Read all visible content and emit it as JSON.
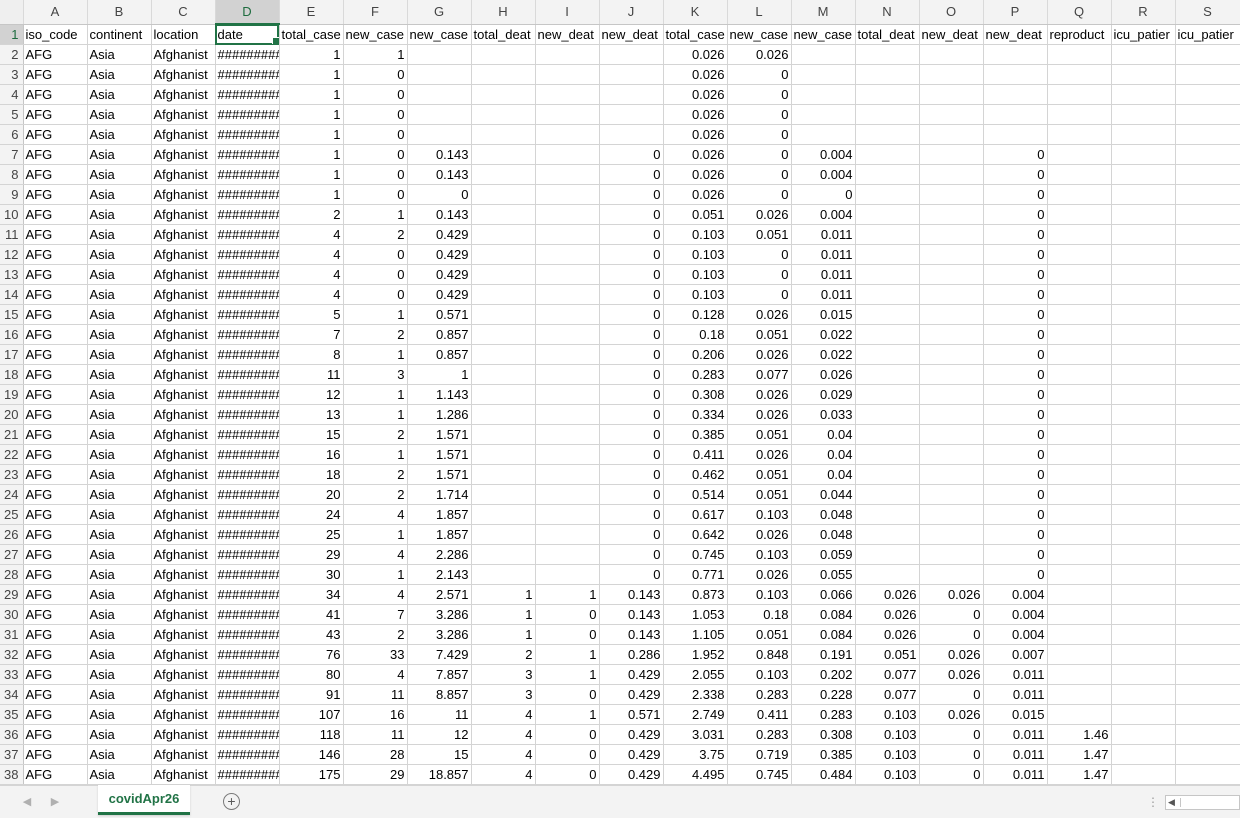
{
  "columns": [
    "A",
    "B",
    "C",
    "D",
    "E",
    "F",
    "G",
    "H",
    "I",
    "J",
    "K",
    "L",
    "M",
    "N",
    "O",
    "P",
    "Q",
    "R",
    "S"
  ],
  "column_types": [
    "txt",
    "txt",
    "txt",
    "txt",
    "num",
    "num",
    "num",
    "num",
    "num",
    "num",
    "num",
    "num",
    "num",
    "num",
    "num",
    "num",
    "num",
    "txt",
    "txt"
  ],
  "selected_column": "D",
  "active_cell": {
    "row": 1,
    "col": 3
  },
  "rows": [
    [
      "iso_code",
      "continent",
      "location",
      "date",
      "total_case",
      "new_case",
      "new_case",
      "total_deat",
      "new_deat",
      "new_deat",
      "total_case",
      "new_case",
      "new_case",
      "total_deat",
      "new_deat",
      "new_deat",
      "reproduct",
      "icu_patier",
      "icu_patier"
    ],
    [
      "AFG",
      "Asia",
      "Afghanist",
      "#########",
      "1",
      "1",
      "",
      "",
      "",
      "",
      "0.026",
      "0.026",
      "",
      "",
      "",
      "",
      "",
      "",
      ""
    ],
    [
      "AFG",
      "Asia",
      "Afghanist",
      "#########",
      "1",
      "0",
      "",
      "",
      "",
      "",
      "0.026",
      "0",
      "",
      "",
      "",
      "",
      "",
      "",
      ""
    ],
    [
      "AFG",
      "Asia",
      "Afghanist",
      "#########",
      "1",
      "0",
      "",
      "",
      "",
      "",
      "0.026",
      "0",
      "",
      "",
      "",
      "",
      "",
      "",
      ""
    ],
    [
      "AFG",
      "Asia",
      "Afghanist",
      "#########",
      "1",
      "0",
      "",
      "",
      "",
      "",
      "0.026",
      "0",
      "",
      "",
      "",
      "",
      "",
      "",
      ""
    ],
    [
      "AFG",
      "Asia",
      "Afghanist",
      "#########",
      "1",
      "0",
      "",
      "",
      "",
      "",
      "0.026",
      "0",
      "",
      "",
      "",
      "",
      "",
      "",
      ""
    ],
    [
      "AFG",
      "Asia",
      "Afghanist",
      "#########",
      "1",
      "0",
      "0.143",
      "",
      "",
      "0",
      "0.026",
      "0",
      "0.004",
      "",
      "",
      "0",
      "",
      "",
      ""
    ],
    [
      "AFG",
      "Asia",
      "Afghanist",
      "#########",
      "1",
      "0",
      "0.143",
      "",
      "",
      "0",
      "0.026",
      "0",
      "0.004",
      "",
      "",
      "0",
      "",
      "",
      ""
    ],
    [
      "AFG",
      "Asia",
      "Afghanist",
      "#########",
      "1",
      "0",
      "0",
      "",
      "",
      "0",
      "0.026",
      "0",
      "0",
      "",
      "",
      "0",
      "",
      "",
      ""
    ],
    [
      "AFG",
      "Asia",
      "Afghanist",
      "#########",
      "2",
      "1",
      "0.143",
      "",
      "",
      "0",
      "0.051",
      "0.026",
      "0.004",
      "",
      "",
      "0",
      "",
      "",
      ""
    ],
    [
      "AFG",
      "Asia",
      "Afghanist",
      "#########",
      "4",
      "2",
      "0.429",
      "",
      "",
      "0",
      "0.103",
      "0.051",
      "0.011",
      "",
      "",
      "0",
      "",
      "",
      ""
    ],
    [
      "AFG",
      "Asia",
      "Afghanist",
      "#########",
      "4",
      "0",
      "0.429",
      "",
      "",
      "0",
      "0.103",
      "0",
      "0.011",
      "",
      "",
      "0",
      "",
      "",
      ""
    ],
    [
      "AFG",
      "Asia",
      "Afghanist",
      "#########",
      "4",
      "0",
      "0.429",
      "",
      "",
      "0",
      "0.103",
      "0",
      "0.011",
      "",
      "",
      "0",
      "",
      "",
      ""
    ],
    [
      "AFG",
      "Asia",
      "Afghanist",
      "#########",
      "4",
      "0",
      "0.429",
      "",
      "",
      "0",
      "0.103",
      "0",
      "0.011",
      "",
      "",
      "0",
      "",
      "",
      ""
    ],
    [
      "AFG",
      "Asia",
      "Afghanist",
      "#########",
      "5",
      "1",
      "0.571",
      "",
      "",
      "0",
      "0.128",
      "0.026",
      "0.015",
      "",
      "",
      "0",
      "",
      "",
      ""
    ],
    [
      "AFG",
      "Asia",
      "Afghanist",
      "#########",
      "7",
      "2",
      "0.857",
      "",
      "",
      "0",
      "0.18",
      "0.051",
      "0.022",
      "",
      "",
      "0",
      "",
      "",
      ""
    ],
    [
      "AFG",
      "Asia",
      "Afghanist",
      "#########",
      "8",
      "1",
      "0.857",
      "",
      "",
      "0",
      "0.206",
      "0.026",
      "0.022",
      "",
      "",
      "0",
      "",
      "",
      ""
    ],
    [
      "AFG",
      "Asia",
      "Afghanist",
      "#########",
      "11",
      "3",
      "1",
      "",
      "",
      "0",
      "0.283",
      "0.077",
      "0.026",
      "",
      "",
      "0",
      "",
      "",
      ""
    ],
    [
      "AFG",
      "Asia",
      "Afghanist",
      "#########",
      "12",
      "1",
      "1.143",
      "",
      "",
      "0",
      "0.308",
      "0.026",
      "0.029",
      "",
      "",
      "0",
      "",
      "",
      ""
    ],
    [
      "AFG",
      "Asia",
      "Afghanist",
      "#########",
      "13",
      "1",
      "1.286",
      "",
      "",
      "0",
      "0.334",
      "0.026",
      "0.033",
      "",
      "",
      "0",
      "",
      "",
      ""
    ],
    [
      "AFG",
      "Asia",
      "Afghanist",
      "#########",
      "15",
      "2",
      "1.571",
      "",
      "",
      "0",
      "0.385",
      "0.051",
      "0.04",
      "",
      "",
      "0",
      "",
      "",
      ""
    ],
    [
      "AFG",
      "Asia",
      "Afghanist",
      "#########",
      "16",
      "1",
      "1.571",
      "",
      "",
      "0",
      "0.411",
      "0.026",
      "0.04",
      "",
      "",
      "0",
      "",
      "",
      ""
    ],
    [
      "AFG",
      "Asia",
      "Afghanist",
      "#########",
      "18",
      "2",
      "1.571",
      "",
      "",
      "0",
      "0.462",
      "0.051",
      "0.04",
      "",
      "",
      "0",
      "",
      "",
      ""
    ],
    [
      "AFG",
      "Asia",
      "Afghanist",
      "#########",
      "20",
      "2",
      "1.714",
      "",
      "",
      "0",
      "0.514",
      "0.051",
      "0.044",
      "",
      "",
      "0",
      "",
      "",
      ""
    ],
    [
      "AFG",
      "Asia",
      "Afghanist",
      "#########",
      "24",
      "4",
      "1.857",
      "",
      "",
      "0",
      "0.617",
      "0.103",
      "0.048",
      "",
      "",
      "0",
      "",
      "",
      ""
    ],
    [
      "AFG",
      "Asia",
      "Afghanist",
      "#########",
      "25",
      "1",
      "1.857",
      "",
      "",
      "0",
      "0.642",
      "0.026",
      "0.048",
      "",
      "",
      "0",
      "",
      "",
      ""
    ],
    [
      "AFG",
      "Asia",
      "Afghanist",
      "#########",
      "29",
      "4",
      "2.286",
      "",
      "",
      "0",
      "0.745",
      "0.103",
      "0.059",
      "",
      "",
      "0",
      "",
      "",
      ""
    ],
    [
      "AFG",
      "Asia",
      "Afghanist",
      "#########",
      "30",
      "1",
      "2.143",
      "",
      "",
      "0",
      "0.771",
      "0.026",
      "0.055",
      "",
      "",
      "0",
      "",
      "",
      ""
    ],
    [
      "AFG",
      "Asia",
      "Afghanist",
      "#########",
      "34",
      "4",
      "2.571",
      "1",
      "1",
      "0.143",
      "0.873",
      "0.103",
      "0.066",
      "0.026",
      "0.026",
      "0.004",
      "",
      "",
      ""
    ],
    [
      "AFG",
      "Asia",
      "Afghanist",
      "#########",
      "41",
      "7",
      "3.286",
      "1",
      "0",
      "0.143",
      "1.053",
      "0.18",
      "0.084",
      "0.026",
      "0",
      "0.004",
      "",
      "",
      ""
    ],
    [
      "AFG",
      "Asia",
      "Afghanist",
      "#########",
      "43",
      "2",
      "3.286",
      "1",
      "0",
      "0.143",
      "1.105",
      "0.051",
      "0.084",
      "0.026",
      "0",
      "0.004",
      "",
      "",
      ""
    ],
    [
      "AFG",
      "Asia",
      "Afghanist",
      "#########",
      "76",
      "33",
      "7.429",
      "2",
      "1",
      "0.286",
      "1.952",
      "0.848",
      "0.191",
      "0.051",
      "0.026",
      "0.007",
      "",
      "",
      ""
    ],
    [
      "AFG",
      "Asia",
      "Afghanist",
      "#########",
      "80",
      "4",
      "7.857",
      "3",
      "1",
      "0.429",
      "2.055",
      "0.103",
      "0.202",
      "0.077",
      "0.026",
      "0.011",
      "",
      "",
      ""
    ],
    [
      "AFG",
      "Asia",
      "Afghanist",
      "#########",
      "91",
      "11",
      "8.857",
      "3",
      "0",
      "0.429",
      "2.338",
      "0.283",
      "0.228",
      "0.077",
      "0",
      "0.011",
      "",
      "",
      ""
    ],
    [
      "AFG",
      "Asia",
      "Afghanist",
      "#########",
      "107",
      "16",
      "11",
      "4",
      "1",
      "0.571",
      "2.749",
      "0.411",
      "0.283",
      "0.103",
      "0.026",
      "0.015",
      "",
      "",
      ""
    ],
    [
      "AFG",
      "Asia",
      "Afghanist",
      "#########",
      "118",
      "11",
      "12",
      "4",
      "0",
      "0.429",
      "3.031",
      "0.283",
      "0.308",
      "0.103",
      "0",
      "0.011",
      "1.46",
      "",
      ""
    ],
    [
      "AFG",
      "Asia",
      "Afghanist",
      "#########",
      "146",
      "28",
      "15",
      "4",
      "0",
      "0.429",
      "3.75",
      "0.719",
      "0.385",
      "0.103",
      "0",
      "0.011",
      "1.47",
      "",
      ""
    ],
    [
      "AFG",
      "Asia",
      "Afghanist",
      "#########",
      "175",
      "29",
      "18.857",
      "4",
      "0",
      "0.429",
      "4.495",
      "0.745",
      "0.484",
      "0.103",
      "0",
      "0.011",
      "1.47",
      "",
      ""
    ]
  ],
  "sheet_tab": {
    "label": "covidApr26"
  },
  "icons": {
    "prev_sheet": "chevron-left-icon",
    "next_sheet": "chevron-right-icon",
    "add_sheet": "plus-circle-icon"
  },
  "colors": {
    "accent": "#217346",
    "header_bg": "#f3f3f3",
    "gridline": "#d4d4d4"
  }
}
